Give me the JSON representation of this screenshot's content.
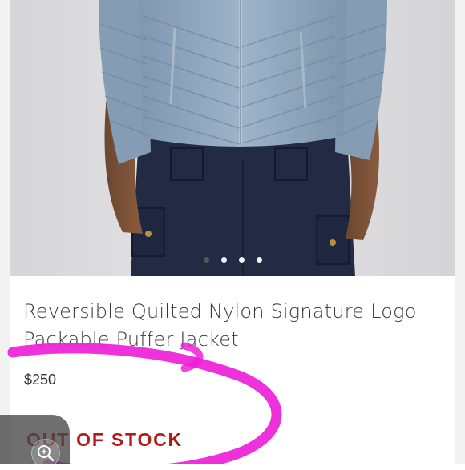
{
  "product": {
    "title": "Reversible Quilted Nylon Signature Logo Packable Puffer Jacket",
    "price": "$250",
    "stock_status": "OUT OF STOCK"
  },
  "carousel": {
    "image_count": 4,
    "active_index": 0
  },
  "colors": {
    "jacket": "#8fa8bf",
    "pants": "#232a44",
    "stock_text": "#b21a1a",
    "annotation": "#ee20d8",
    "dot_active": "#5a5a5a",
    "dot_inactive": "#ffffff"
  },
  "icons": {
    "visual_search": "sparkle-search-icon"
  }
}
